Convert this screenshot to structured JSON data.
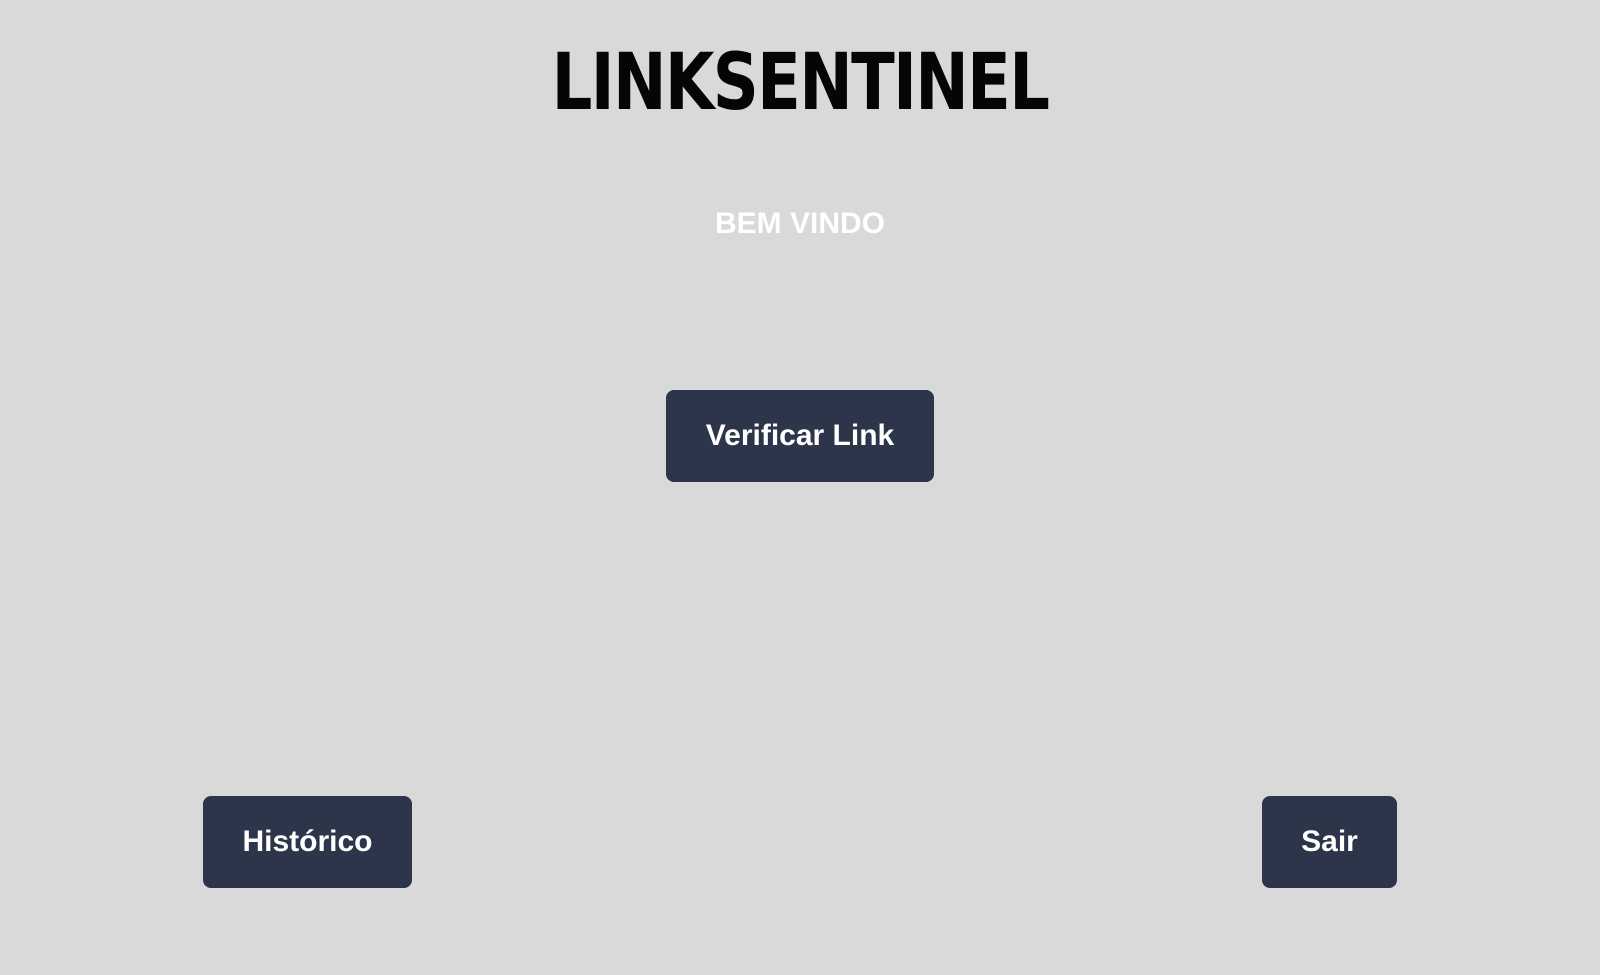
{
  "app": {
    "logo_text": "LINKSENTINEL"
  },
  "main": {
    "welcome_text": "BEM VINDO",
    "verify_button_label": "Verificar Link"
  },
  "footer": {
    "history_button_label": "Histórico",
    "exit_button_label": "Sair"
  },
  "colors": {
    "background": "#d9d9d9",
    "button": "#2c3549",
    "button_text": "#ffffff",
    "logo": "#050505",
    "welcome": "#ffffff"
  }
}
